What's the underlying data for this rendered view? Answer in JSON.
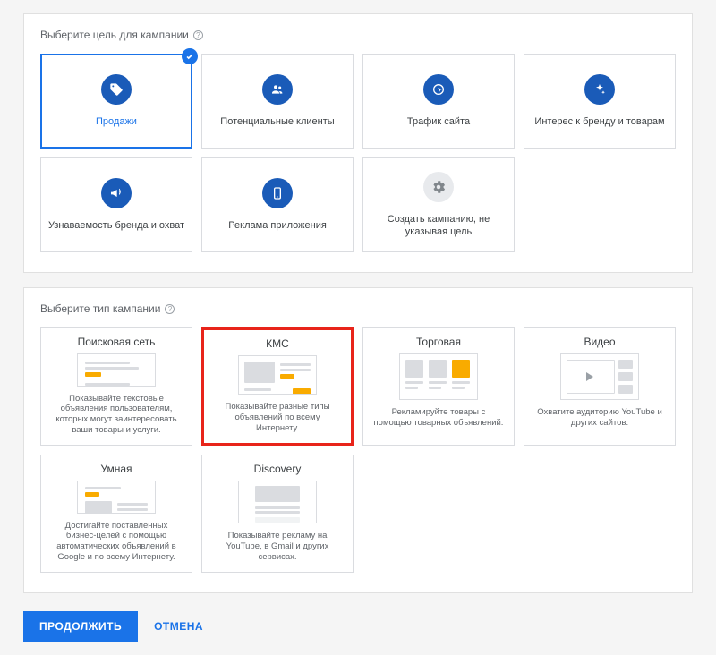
{
  "goalsSection": {
    "title": "Выберите цель для кампании",
    "cards": [
      {
        "label": "Продажи",
        "icon": "tag",
        "selected": true
      },
      {
        "label": "Потенциальные клиенты",
        "icon": "people",
        "selected": false
      },
      {
        "label": "Трафик сайта",
        "icon": "cursor",
        "selected": false
      },
      {
        "label": "Интерес к бренду и товарам",
        "icon": "sparkle",
        "selected": false
      },
      {
        "label": "Узнаваемость бренда и охват",
        "icon": "megaphone",
        "selected": false
      },
      {
        "label": "Реклама приложения",
        "icon": "app",
        "selected": false
      },
      {
        "label": "Создать кампанию, не указывая цель",
        "icon": "gear",
        "selected": false
      }
    ]
  },
  "typesSection": {
    "title": "Выберите тип кампании",
    "cards": [
      {
        "title": "Поисковая сеть",
        "desc": "Показывайте текстовые объявления пользователям, которых могут заинтересовать ваши товары и услуги.",
        "thumb": "search",
        "highlight": false
      },
      {
        "title": "КМС",
        "desc": "Показывайте разные типы объявлений по всему Интернету.",
        "thumb": "display",
        "highlight": true
      },
      {
        "title": "Торговая",
        "desc": "Рекламируйте товары с помощью товарных объявлений.",
        "thumb": "shopping",
        "highlight": false
      },
      {
        "title": "Видео",
        "desc": "Охватите аудиторию YouTube и других сайтов.",
        "thumb": "video",
        "highlight": false
      },
      {
        "title": "Умная",
        "desc": "Достигайте поставленных бизнес-целей с помощью автоматических объявлений в Google и по всему Интернету.",
        "thumb": "smart",
        "highlight": false
      },
      {
        "title": "Discovery",
        "desc": "Показывайте рекламу на YouTube, в Gmail и других сервисах.",
        "thumb": "discovery",
        "highlight": false
      }
    ]
  },
  "footer": {
    "continue": "ПРОДОЛЖИТЬ",
    "cancel": "ОТМЕНА"
  }
}
